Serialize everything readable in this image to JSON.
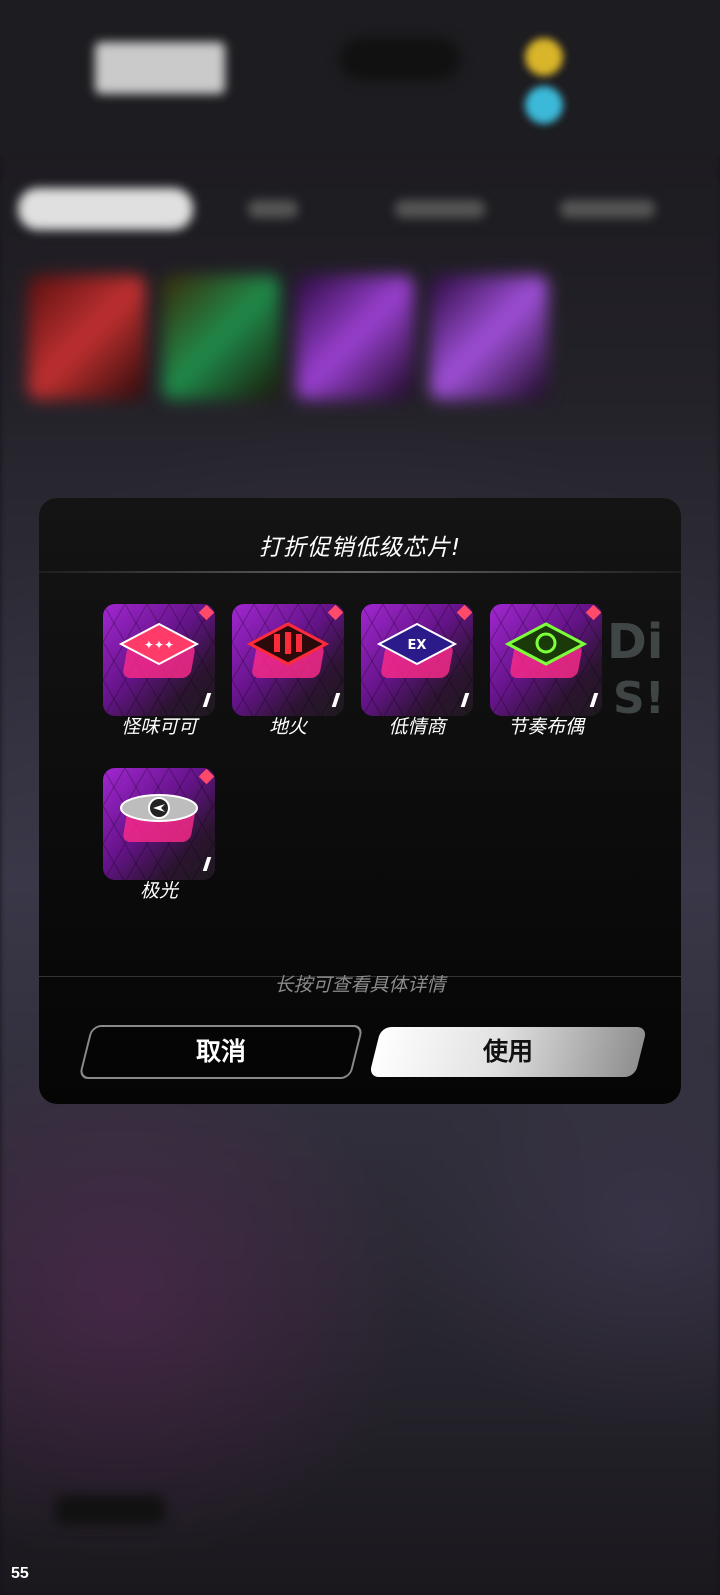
{
  "dialog": {
    "title": "打折促销低级芯片!",
    "hint": "长按可查看具体详情",
    "cancel_label": "取消",
    "use_label": "使用",
    "chips": [
      {
        "name": "怪味可可",
        "icon": "cocoa-chip-icon",
        "accent": "#ff3b6a"
      },
      {
        "name": "地火",
        "icon": "earthfire-chip-icon",
        "accent": "#ff2a3a"
      },
      {
        "name": "低情商",
        "icon": "low-eq-chip-icon",
        "accent": "#6a5cff"
      },
      {
        "name": "节奏布偶",
        "icon": "rhythm-doll-chip-icon",
        "accent": "#7dff3a"
      },
      {
        "name": "极光",
        "icon": "aurora-chip-icon",
        "accent": "#d0d0d0"
      }
    ]
  },
  "status": {
    "page_number": "55"
  },
  "colors": {
    "chip_badge": "#ff4a6a",
    "chip_background": "#a828dc",
    "hint_text": "#8b8b8b"
  }
}
